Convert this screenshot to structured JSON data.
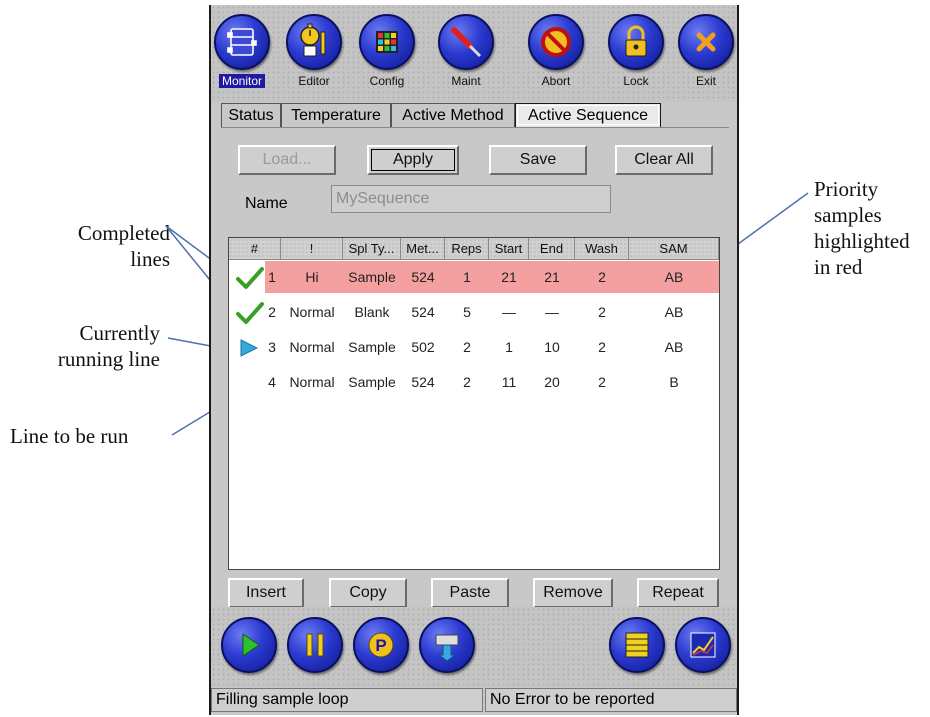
{
  "annotations": {
    "completed": "Completed\nlines",
    "running": "Currently\nrunning line",
    "to_run": "Line to be run",
    "priority": "Priority\nsamples\nhighlighted\nin red"
  },
  "toolbar": [
    {
      "label": "Monitor",
      "icon": "monitor-icon",
      "active": true
    },
    {
      "label": "Editor",
      "icon": "stopwatch-icon",
      "active": false
    },
    {
      "label": "Config",
      "icon": "grid-icon",
      "active": false
    },
    {
      "label": "Maint",
      "icon": "screwdriver-icon",
      "active": false
    },
    {
      "label": "Abort",
      "icon": "no-entry-icon",
      "active": false
    },
    {
      "label": "Lock",
      "icon": "padlock-icon",
      "active": false
    },
    {
      "label": "Exit",
      "icon": "close-x-icon",
      "active": false
    }
  ],
  "tabs": [
    "Status",
    "Temperature",
    "Active Method",
    "Active Sequence"
  ],
  "active_tab": "Active Sequence",
  "actions": {
    "load": "Load...",
    "apply": "Apply",
    "save": "Save",
    "clear_all": "Clear All"
  },
  "name": {
    "label": "Name",
    "value": "MySequence"
  },
  "table": {
    "headers": [
      "#",
      "!",
      "Spl Ty...",
      "Met...",
      "Reps",
      "Start",
      "End",
      "Wash",
      "SAM"
    ],
    "rows": [
      {
        "status": "completed",
        "num": "1",
        "priority": "Hi",
        "type": "Sample",
        "method": "524",
        "reps": "1",
        "start": "21",
        "end": "21",
        "wash": "2",
        "sam": "AB"
      },
      {
        "status": "completed",
        "num": "2",
        "priority": "Normal",
        "type": "Blank",
        "method": "524",
        "reps": "5",
        "start": "—",
        "end": "—",
        "wash": "2",
        "sam": "AB"
      },
      {
        "status": "running",
        "num": "3",
        "priority": "Normal",
        "type": "Sample",
        "method": "502",
        "reps": "2",
        "start": "1",
        "end": "10",
        "wash": "2",
        "sam": "AB"
      },
      {
        "status": "pending",
        "num": "4",
        "priority": "Normal",
        "type": "Sample",
        "method": "524",
        "reps": "2",
        "start": "11",
        "end": "20",
        "wash": "2",
        "sam": "B"
      }
    ]
  },
  "row_buttons": {
    "insert": "Insert",
    "copy": "Copy",
    "paste": "Paste",
    "remove": "Remove",
    "repeat": "Repeat"
  },
  "status_bar": {
    "left": "Filling sample loop",
    "right": "No Error to be reported"
  },
  "colors": {
    "priority_row": "#f4a0a0",
    "orb_blue": "#2b3ad0",
    "active_label": "#1f1aa0",
    "check_green": "#3aa025",
    "play_cyan": "#35a8e0"
  }
}
